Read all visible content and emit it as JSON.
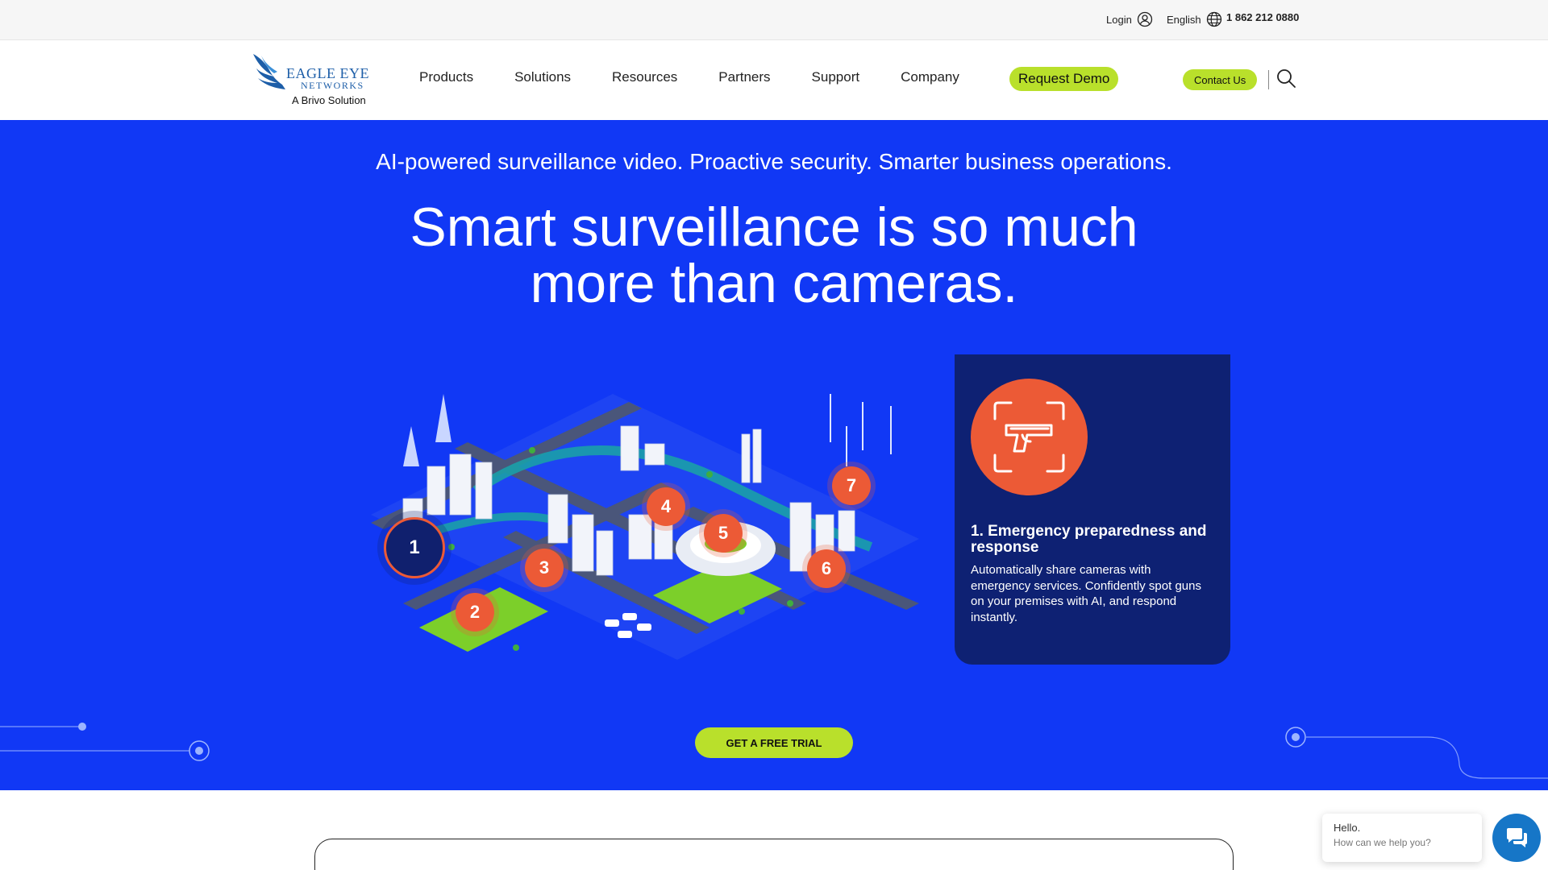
{
  "topbar": {
    "login_label": "Login",
    "language_label": "English",
    "phone": "1 862 212 0880"
  },
  "logo": {
    "line1": "EAGLE EYE",
    "line2": "NETWORKS",
    "subtitle": "A Brivo Solution"
  },
  "nav": {
    "items": [
      {
        "label": "Products"
      },
      {
        "label": "Solutions"
      },
      {
        "label": "Resources"
      },
      {
        "label": "Partners"
      },
      {
        "label": "Support"
      },
      {
        "label": "Company"
      }
    ],
    "request_demo_label": "Request Demo",
    "contact_label": "Contact Us"
  },
  "hero": {
    "tagline": "AI-powered surveillance video. Proactive security. Smarter business operations.",
    "headline_line1": "Smart surveillance is so much",
    "headline_line2": "more than cameras.",
    "markers": [
      {
        "label": "1",
        "active": true
      },
      {
        "label": "2",
        "active": false
      },
      {
        "label": "3",
        "active": false
      },
      {
        "label": "4",
        "active": false
      },
      {
        "label": "5",
        "active": false
      },
      {
        "label": "6",
        "active": false
      },
      {
        "label": "7",
        "active": false
      }
    ],
    "card": {
      "icon": "gun-scan-icon",
      "title": "1. Emergency preparedness and response",
      "description": "Automatically share cameras with emergency services. Confidently spot guns on your premises with AI, and respond instantly."
    },
    "cta_label": "GET A FREE TRIAL"
  },
  "chat": {
    "greeting": "Hello.",
    "prompt": "How can we help you?"
  },
  "colors": {
    "hero_blue": "#1138f5",
    "card_navy": "#0e2173",
    "accent_green": "#b9e02b",
    "marker_orange": "#ec5a36",
    "chat_blue": "#1676c7"
  }
}
